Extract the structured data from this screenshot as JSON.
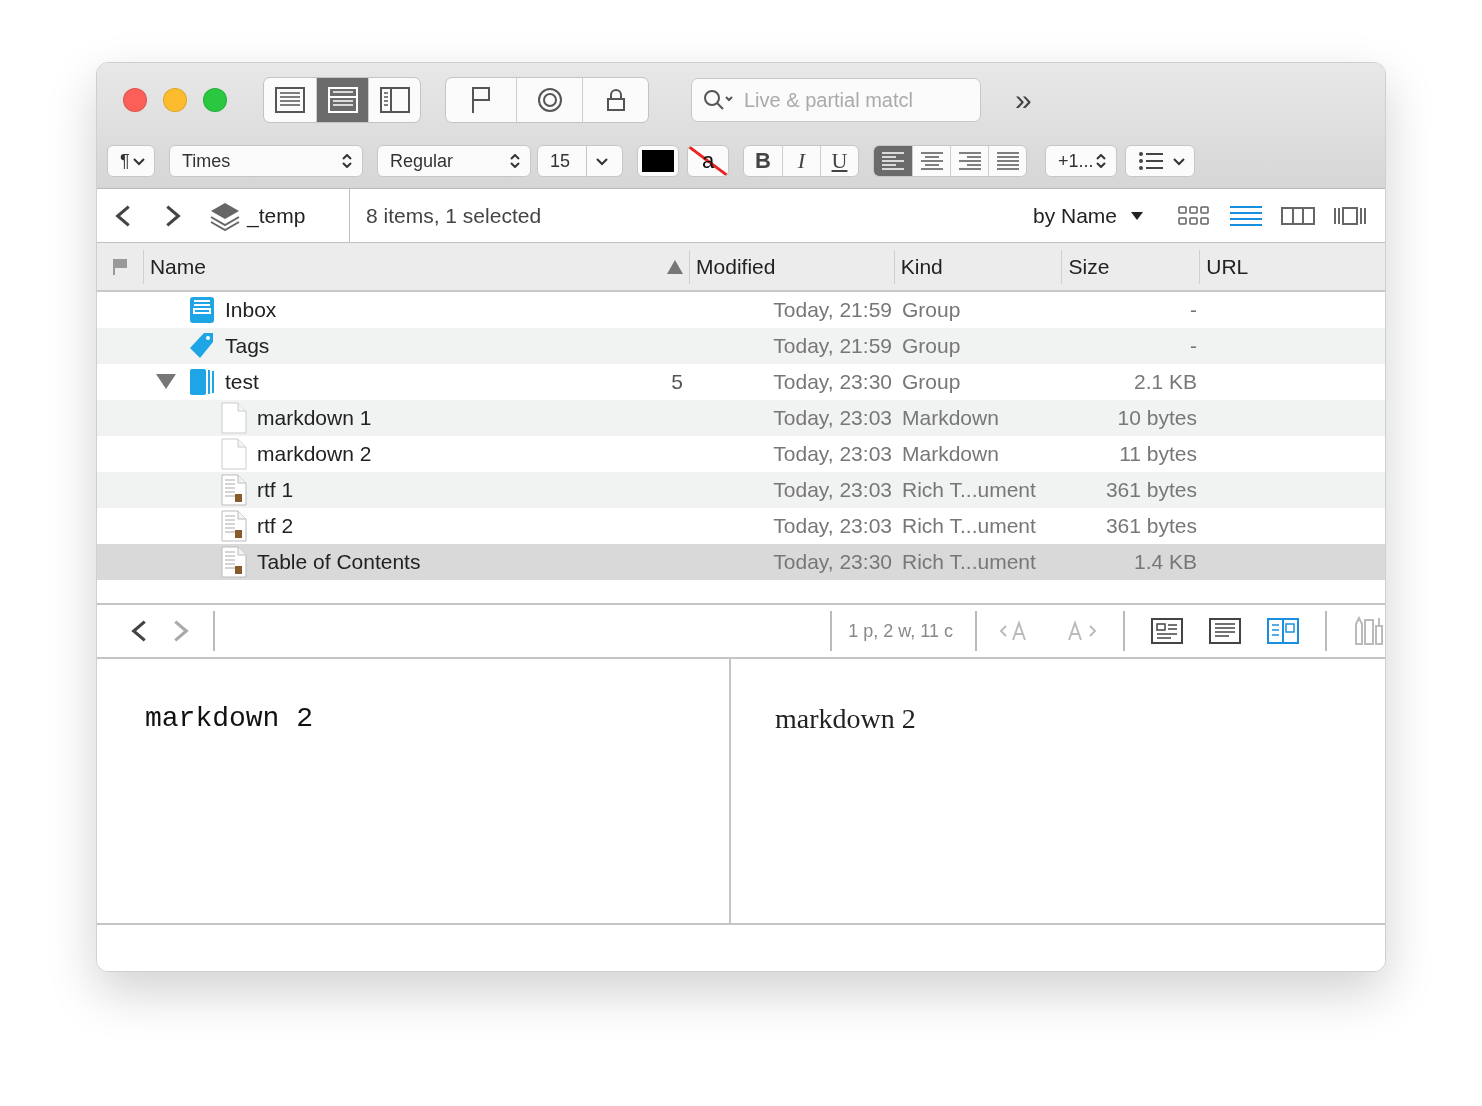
{
  "toolbar": {
    "view_modes": [
      {
        "selected": false
      },
      {
        "selected": true
      },
      {
        "selected": false
      }
    ],
    "search": {
      "placeholder": "Live & partial matcl"
    },
    "overflow": "»"
  },
  "format_bar": {
    "paragraph": "¶",
    "font": "Times",
    "style": "Regular",
    "size": "15",
    "strike_sample": "a",
    "styles": [
      "B",
      "I",
      "U"
    ],
    "alignment": [
      {
        "selected": true
      },
      {
        "selected": false
      },
      {
        "selected": false
      },
      {
        "selected": false
      }
    ],
    "spacing": "+1..."
  },
  "path_bar": {
    "folder": "_temp",
    "status": "8 items, 1 selected",
    "sort": "by Name",
    "views": [
      {
        "selected": false
      },
      {
        "selected": true
      },
      {
        "selected": false
      },
      {
        "selected": false
      }
    ]
  },
  "columns": [
    {
      "label": "Name",
      "sorted": true
    },
    {
      "label": "Modified",
      "sorted": false
    },
    {
      "label": "Kind",
      "sorted": false
    },
    {
      "label": "Size",
      "sorted": false
    },
    {
      "label": "URL",
      "sorted": false
    }
  ],
  "rows": [
    {
      "name": "Inbox",
      "kind": "inbox",
      "modified": "Today, 21:59",
      "kind_text": "Group",
      "size": "-",
      "selected": false
    },
    {
      "name": "Tags",
      "kind": "tag",
      "modified": "Today, 21:59",
      "kind_text": "Group",
      "size": "-",
      "selected": false
    },
    {
      "name": "test",
      "kind": "group",
      "count": "5",
      "modified": "Today, 23:30",
      "kind_text": "Group",
      "size": "2.1 KB",
      "selected": false,
      "expanded": true,
      "children": [
        {
          "name": "markdown 1",
          "kind": "markdown",
          "modified": "Today, 23:03",
          "kind_text": "Markdown",
          "size": "10 bytes",
          "selected": false
        },
        {
          "name": "markdown 2",
          "kind": "markdown",
          "modified": "Today, 23:03",
          "kind_text": "Markdown",
          "size": "11 bytes",
          "selected": false
        },
        {
          "name": "rtf 1",
          "kind": "rtf",
          "modified": "Today, 23:03",
          "kind_text": "Rich T...ument",
          "size": "361 bytes",
          "selected": false
        },
        {
          "name": "rtf 2",
          "kind": "rtf",
          "modified": "Today, 23:03",
          "kind_text": "Rich T...ument",
          "size": "361 bytes",
          "selected": false
        },
        {
          "name": "Table of Contents",
          "kind": "rtf",
          "modified": "Today, 23:30",
          "kind_text": "Rich T...ument",
          "size": "1.4 KB",
          "selected": true
        }
      ]
    }
  ],
  "editor": {
    "stats": "1 p, 2 w, 11 c",
    "layouts": [
      {
        "selected": false
      },
      {
        "selected": false
      },
      {
        "selected": true
      }
    ],
    "source_text": "markdown 2",
    "preview_text": "markdown 2"
  }
}
